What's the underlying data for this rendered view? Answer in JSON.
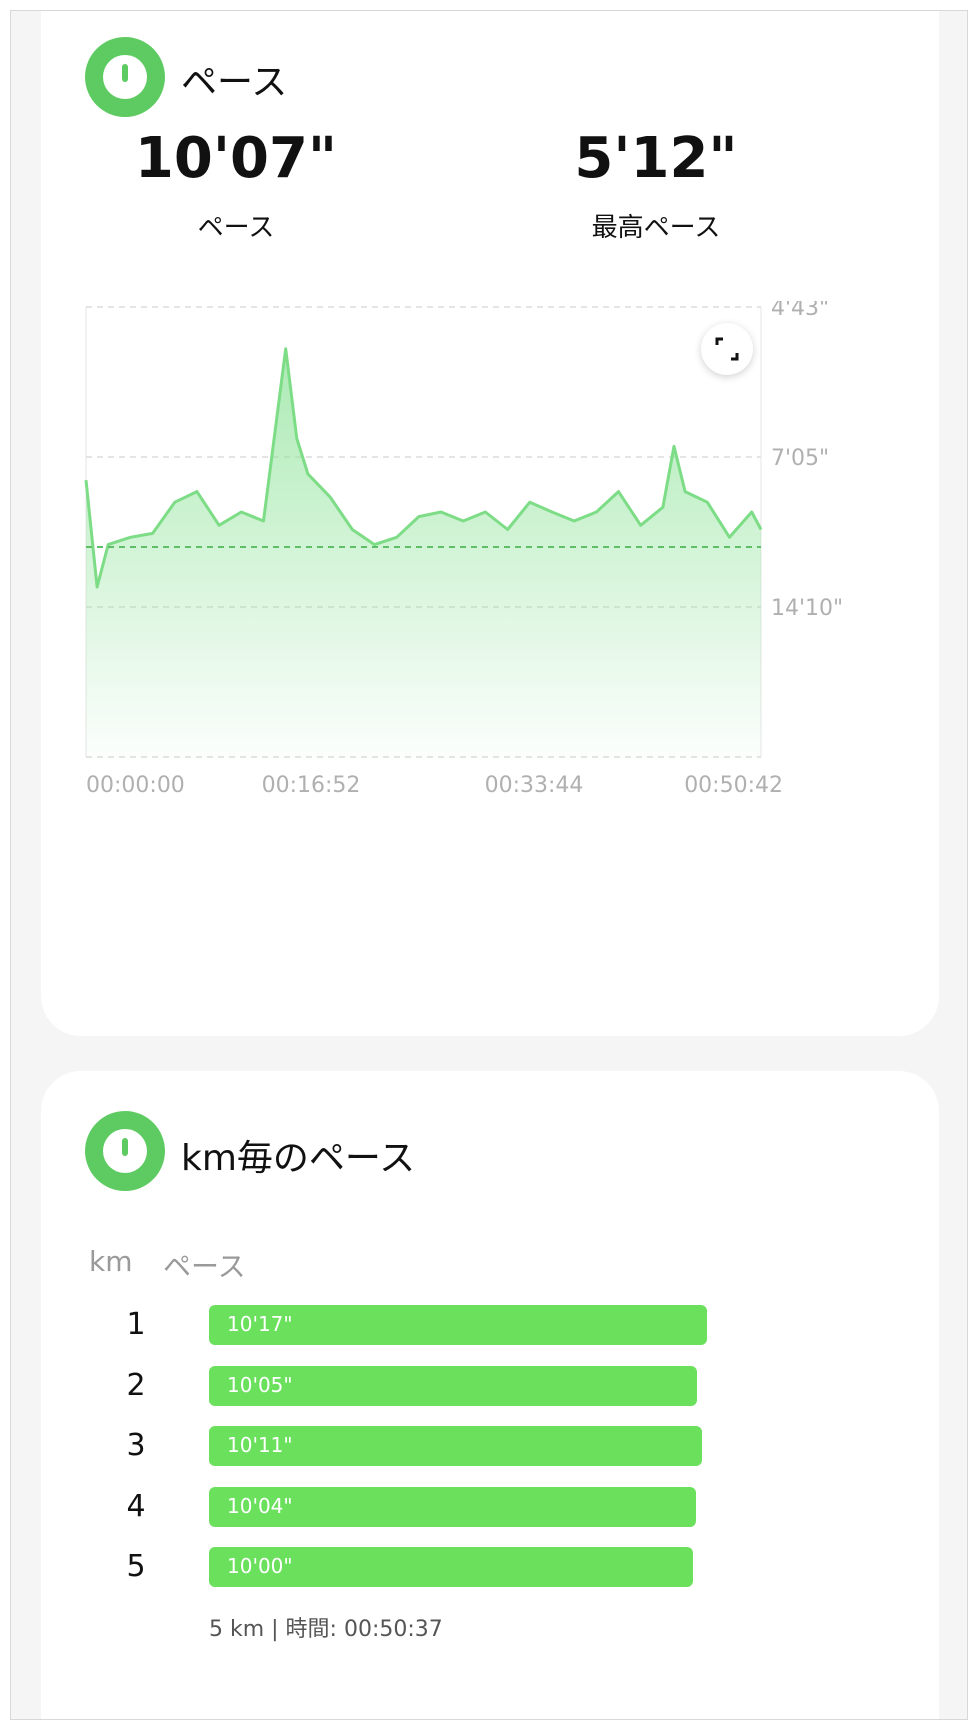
{
  "pace_section": {
    "title": "ペース",
    "avg_value": "10'07\"",
    "avg_label": "ペース",
    "best_value": "5'12\"",
    "best_label": "最高ペース",
    "icon": "speedometer-icon",
    "expand_icon": "expand-icon"
  },
  "chart_data": {
    "type": "area",
    "y_tick_labels": [
      "4'43\"",
      "7'05\"",
      "14'10\""
    ],
    "x_tick_labels": [
      "00:00:00",
      "00:16:52",
      "00:33:44",
      "00:50:42"
    ],
    "x_range_seconds": [
      0,
      3042
    ],
    "average_line_label": "10'07\"",
    "grid": "dashed horizontal",
    "color": "#7ddc86",
    "x": [
      0,
      50,
      100,
      200,
      300,
      400,
      500,
      600,
      700,
      800,
      900,
      950,
      1000,
      1100,
      1200,
      1300,
      1400,
      1500,
      1600,
      1700,
      1800,
      1900,
      2000,
      2100,
      2200,
      2300,
      2400,
      2500,
      2600,
      2650,
      2700,
      2800,
      2900,
      3000,
      3042
    ],
    "y_pace": [
      "7'40\"",
      "12'30\"",
      "10'00\"",
      "9'40\"",
      "9'30\"",
      "8'20\"",
      "8'00\"",
      "9'10\"",
      "8'40\"",
      "9'00\"",
      "5'12\"",
      "6'40\"",
      "7'30\"",
      "8'10\"",
      "9'20\"",
      "10'00\"",
      "9'40\"",
      "8'50\"",
      "8'40\"",
      "9'00\"",
      "8'40\"",
      "9'20\"",
      "8'20\"",
      "8'40\"",
      "9'00\"",
      "8'40\"",
      "8'00\"",
      "9'10\"",
      "8'30\"",
      "6'50\"",
      "8'00\"",
      "8'20\"",
      "9'40\"",
      "8'40\"",
      "9'20\""
    ]
  },
  "km_section": {
    "title": "km毎のペース",
    "icon": "speedometer-icon",
    "col_km": "km",
    "col_pace": "ペース",
    "rows": [
      {
        "km": "1",
        "pace": "10'17\"",
        "fraction": 1.0
      },
      {
        "km": "2",
        "pace": "10'05\"",
        "fraction": 0.98
      },
      {
        "km": "3",
        "pace": "10'11\"",
        "fraction": 0.99
      },
      {
        "km": "4",
        "pace": "10'04\"",
        "fraction": 0.978
      },
      {
        "km": "5",
        "pace": "10'00\"",
        "fraction": 0.972
      }
    ],
    "summary": "5 km | 時間: 00:50:37"
  }
}
